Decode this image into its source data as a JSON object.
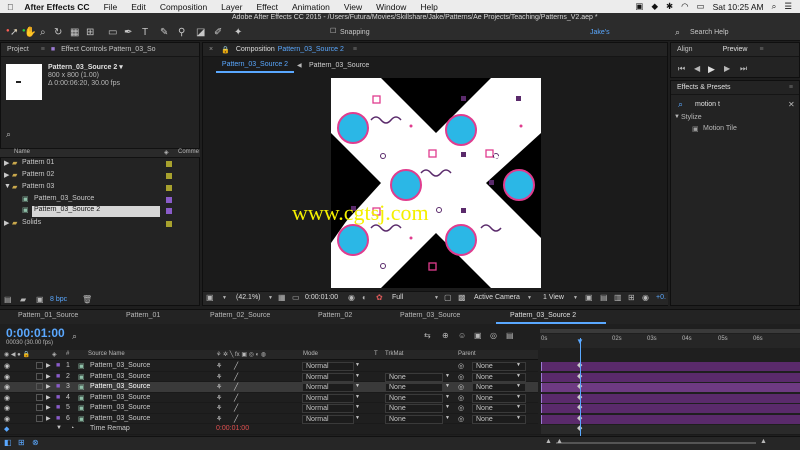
{
  "menubar": {
    "app_name": "After Effects CC",
    "items": [
      "File",
      "Edit",
      "Composition",
      "Layer",
      "Effect",
      "Animation",
      "View",
      "Window",
      "Help"
    ],
    "clock": "Sat 10:25 AM"
  },
  "window": {
    "title": "Adobe After Effects CC 2015 - /Users/Futura/Movies/Skillshare/Jake/Patterns/Ae Projects/Teaching/Patterns_V2.aep *"
  },
  "toolbar": {
    "snapping_label": "Snapping",
    "workspace": "Jake's",
    "search_placeholder": "Search Help"
  },
  "project_panel": {
    "tab_project": "Project",
    "tab_effect_controls": "Effect Controls Pattern_03_So",
    "selected_name": "Pattern_03_Source 2 ▾",
    "selected_dims": "800 x 800 (1.00)",
    "selected_duration": "Δ 0:00:06:20, 30.00 fps",
    "col_name": "Name",
    "col_comment": "Comme",
    "items": [
      {
        "label": "Pattern 01",
        "type": "folder"
      },
      {
        "label": "Pattern 02",
        "type": "folder"
      },
      {
        "label": "Pattern 03",
        "type": "folder"
      },
      {
        "label": "Pattern_03_Source",
        "type": "comp"
      },
      {
        "label": "Pattern_03_Source 2",
        "type": "comp"
      },
      {
        "label": "Solids",
        "type": "folder"
      }
    ],
    "bpc": "8 bpc"
  },
  "comp_panel": {
    "tab_prefix": "Composition",
    "tab_name": "Pattern_03_Source 2",
    "sub_tab_active": "Pattern_03_Source 2",
    "sub_tab_2": "Pattern_03_Source",
    "zoom": "(42.1%)",
    "timecode": "0:00:01:00",
    "resolution": "Full",
    "camera": "Active Camera",
    "views": "1 View",
    "exposure": "+0.",
    "watermark": "www.cgtsj.com"
  },
  "right_panel": {
    "tab_align": "Align",
    "tab_preview": "Preview",
    "effects_title": "Effects & Presets",
    "search_value": "motion t",
    "category": "Stylize",
    "effect": "Motion Tile"
  },
  "timeline": {
    "tabs": [
      "Pattern_01_Source",
      "Pattern_01",
      "Pattern_02_Source",
      "Pattern_02",
      "Pattern_03_Source",
      "Pattern_03_Source 2"
    ],
    "timecode": "0:00:01:00",
    "frame_info": "00030 (30.00 fps)",
    "col_source_name": "Source Name",
    "col_mode": "Mode",
    "col_t": "T",
    "col_trkmat": "TrkMat",
    "col_parent": "Parent",
    "ruler": [
      "0s",
      "02s",
      "03s",
      "04s",
      "05s",
      "06s"
    ],
    "layers": [
      {
        "num": "1",
        "name": "Pattern_03_Source",
        "mode": "Normal",
        "trkmat": "",
        "parent": "None"
      },
      {
        "num": "2",
        "name": "Pattern_03_Source",
        "mode": "Normal",
        "trkmat": "None",
        "parent": "None"
      },
      {
        "num": "3",
        "name": "Pattern_03_Source",
        "mode": "Normal",
        "trkmat": "None",
        "parent": "None"
      },
      {
        "num": "4",
        "name": "Pattern_03_Source",
        "mode": "Normal",
        "trkmat": "None",
        "parent": "None"
      },
      {
        "num": "5",
        "name": "Pattern_03_Source",
        "mode": "Normal",
        "trkmat": "None",
        "parent": "None"
      },
      {
        "num": "6",
        "name": "Pattern_03_Source",
        "mode": "Normal",
        "trkmat": "None",
        "parent": "None"
      }
    ],
    "time_remap_label": "Time Remap",
    "time_remap_value": "0:00:01:00"
  },
  "colors": {
    "accent_blue": "#5aa8ff",
    "label_purple": "#8a5cc9",
    "label_yellow": "#a8a22e",
    "bar_purple": "#5a2a6b"
  }
}
